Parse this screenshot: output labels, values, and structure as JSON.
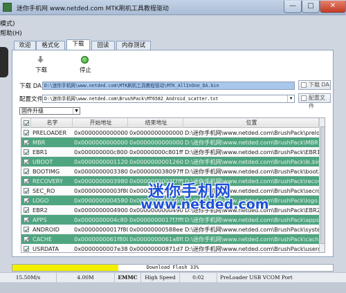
{
  "window": {
    "title": "迷你手机网 www.netded.com MTK刷机工具教程驱动",
    "minimize_glyph": "—",
    "maximize_glyph": "□",
    "close_glyph": "✕"
  },
  "left_cut": {
    "mode": "模式)",
    "help": "帮助(H)"
  },
  "tabs": [
    {
      "label": "欢迎"
    },
    {
      "label": "格式化"
    },
    {
      "label": "下载"
    },
    {
      "label": "回读"
    },
    {
      "label": "内存测试"
    }
  ],
  "toolbar": {
    "download_label": "下载",
    "stop_label": "停止"
  },
  "download_agent": {
    "label": "下载 DA",
    "value": "D:\\迷你手机网\\www.netded.com\\MTK刷机工具教程驱动\\MTK_AllInOne_DA.bin",
    "button": "下载 DA"
  },
  "scatter": {
    "label": "配置文件",
    "value": "D:\\迷你手机网\\www.netded.com\\BrushPack\\MT6582_Android_scatter.txt",
    "button": "配置文件"
  },
  "mode_select": {
    "value": "固件升级"
  },
  "table": {
    "headers": [
      "名字",
      "开始地址",
      "结束地址",
      "位置"
    ],
    "rows": [
      {
        "name": "PRELOADER",
        "start": "0x0000000000000000",
        "end": "0x0000000000000000",
        "location": "D:\\迷你手机网\\www.netded.com\\BrushPack\\preloader_bbk...",
        "style": "white"
      },
      {
        "name": "MBR",
        "start": "0x0000000000000000",
        "end": "0x0000000000000000",
        "location": "D:\\迷你手机网\\www.netded.com\\BrushPack\\MBR",
        "style": "green"
      },
      {
        "name": "EBR1",
        "start": "0x000000000c80000",
        "end": "0x00000000c801ff",
        "location": "D:\\迷你手机网\\www.netded.com\\BrushPack\\EBR1",
        "style": "white"
      },
      {
        "name": "UBOOT",
        "start": "0x0000000001120000",
        "end": "0x0000000001260000",
        "location": "D:\\迷你手机网\\www.netded.com\\BrushPack\\lk.bin",
        "style": "green"
      },
      {
        "name": "BOOTIMG",
        "start": "0x0000000003380000",
        "end": "0x000000038097ff",
        "location": "D:\\迷你手机网\\www.netded.com\\BrushPack\\boot.img",
        "style": "white"
      },
      {
        "name": "RECOVERY",
        "start": "0x0000000003980000",
        "end": "0x0000000003f7fff",
        "location": "D:\\迷你手机网\\www.netded.com\\BrushPack\\recovery.img",
        "style": "green"
      },
      {
        "name": "SEC_RO",
        "start": "0x00000000003f80000",
        "end": "0x0000000003fa0ff",
        "location": "D:\\迷你手机网\\www.netded.com\\BrushPack\\secro.img",
        "style": "white"
      },
      {
        "name": "LOGO",
        "start": "0x0000000004580000",
        "end": "0x0000000004760000",
        "location": "D:\\迷你手机网\\www.netded.com\\BrushPack\\logo.bin",
        "style": "green"
      },
      {
        "name": "EBR2",
        "start": "0x0000000004900000",
        "end": "0x00000000004901ff",
        "location": "D:\\迷你手机网\\www.netded.com\\BrushPack\\EBR2",
        "style": "white"
      },
      {
        "name": "APPS",
        "start": "0x0000000004c80000",
        "end": "0x0000000017f7ffff",
        "location": "D:\\迷你手机网\\www.netded.com\\BrushPack\\apps.img",
        "style": "green"
      },
      {
        "name": "ANDROID",
        "start": "0x00000000017f80000",
        "end": "0x00000000588eefa7",
        "location": "D:\\迷你手机网\\www.netded.com\\BrushPack\\system.img",
        "style": "white"
      },
      {
        "name": "CACHE",
        "start": "0x0000000061f80000",
        "end": "0x0000000061a8f09f",
        "location": "D:\\迷你手机网\\www.netded.com\\BrushPack\\cache.img",
        "style": "green"
      },
      {
        "name": "USRDATA",
        "start": "0x0000000007e380000",
        "end": "0x00000000871d736f",
        "location": "D:\\迷你手机网\\www.netded.com\\BrushPack\\userdata.img",
        "style": "white"
      }
    ]
  },
  "watermark": {
    "title": "迷你手机网",
    "url": "www.netded.com"
  },
  "progress": {
    "percent": 33,
    "text": "Download Flash 33%",
    "color": "#f2f000"
  },
  "status": {
    "speed": "15.50M/s",
    "size": "4.00M",
    "storage": "EMMC",
    "usb_speed": "High Speed",
    "time": "0:02",
    "port": "PreLoader USB VCOM Port"
  },
  "colors": {
    "green_row": "#4fa57f",
    "da_field": "#a8c7ea",
    "close_button": "#c03a22"
  }
}
